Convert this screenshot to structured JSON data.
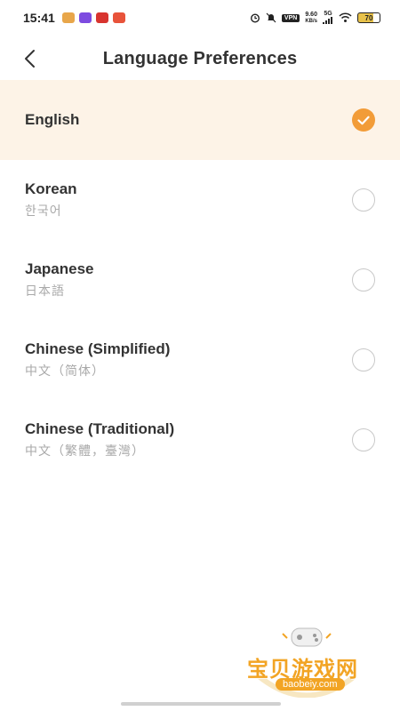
{
  "status_bar": {
    "time": "15:41",
    "app_icons": [
      {
        "name": "notification-app-icon-1",
        "color": "#e8a64a"
      },
      {
        "name": "notification-app-icon-2",
        "color": "#7d4be0"
      },
      {
        "name": "notification-app-icon-3",
        "color": "#d8342f"
      },
      {
        "name": "notification-app-icon-4",
        "color": "#e8533a"
      }
    ],
    "vpn_label": "VPN",
    "net_speed": "9.60",
    "net_speed_unit": "KB/s",
    "network_type": "5G",
    "battery": "70"
  },
  "header": {
    "title": "Language Preferences",
    "back_icon": "chevron-left-icon"
  },
  "languages": [
    {
      "name": "English",
      "native": "",
      "selected": true
    },
    {
      "name": "Korean",
      "native": "한국어",
      "selected": false
    },
    {
      "name": "Japanese",
      "native": "日本語",
      "selected": false
    },
    {
      "name": "Chinese (Simplified)",
      "native": "中文（简体）",
      "selected": false
    },
    {
      "name": "Chinese (Traditional)",
      "native": "中文（繁體，臺灣）",
      "selected": false
    }
  ],
  "watermark": {
    "title": "宝贝游戏网",
    "url": "baobeiy.com"
  },
  "colors": {
    "accent": "#f29c38",
    "selected_bg": "#fdf3e7"
  }
}
